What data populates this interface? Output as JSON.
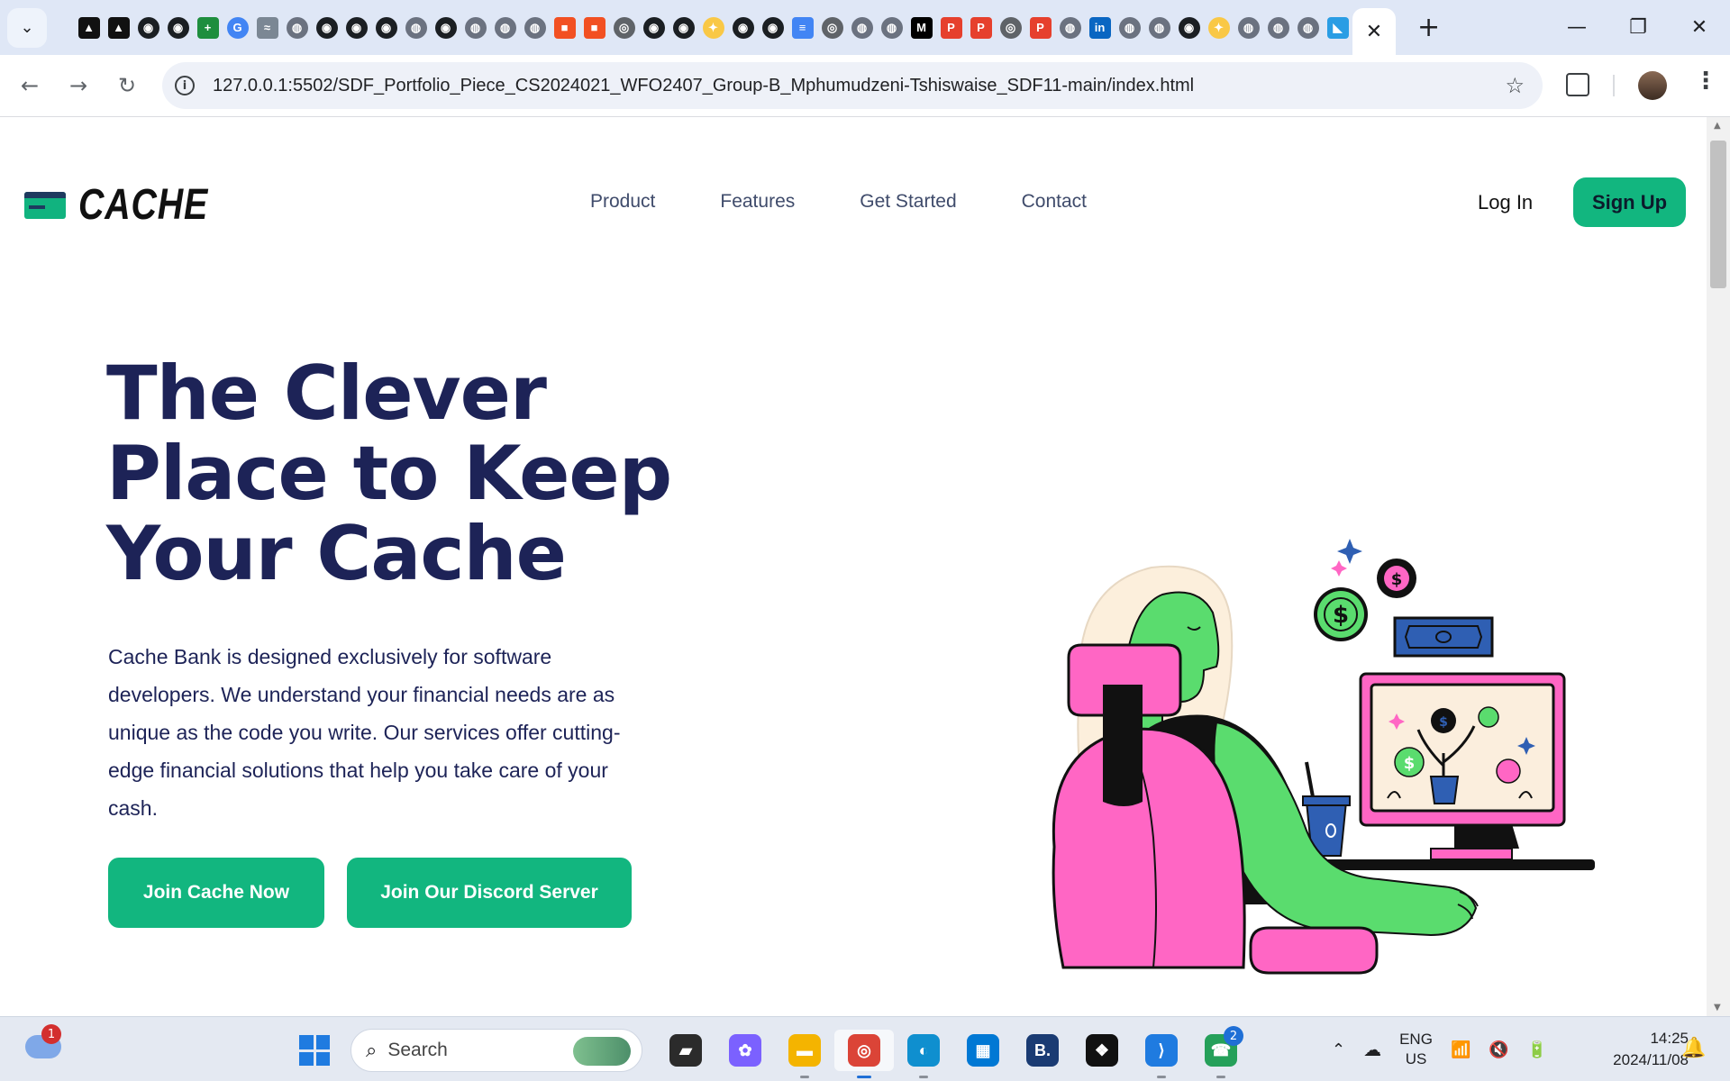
{
  "browser": {
    "active_tab_close": "✕",
    "new_tab": "+",
    "url": "127.0.0.1:5502/SDF_Portfolio_Piece_CS2024021_WFO2407_Group-B_Mphumudzeni-Tshiswaise_SDF11-main/index.html",
    "tab_favicons": [
      "vercel",
      "vercel",
      "github",
      "github",
      "sheets",
      "google",
      "wave",
      "globe",
      "github",
      "github",
      "github",
      "globe",
      "github",
      "globe",
      "globe",
      "globe",
      "microsoft",
      "microsoft",
      "chrome",
      "github",
      "github",
      "gemini",
      "github",
      "github",
      "docs",
      "chrome",
      "globe",
      "globe",
      "medium",
      "pexels",
      "pexels",
      "chrome",
      "pexels",
      "globe",
      "linkedin",
      "globe",
      "globe",
      "github",
      "gemini",
      "globe",
      "globe",
      "globe",
      "vscode"
    ]
  },
  "site": {
    "logo_text": "CACHE",
    "nav": [
      "Product",
      "Features",
      "Get Started",
      "Contact"
    ],
    "login_label": "Log In",
    "signup_label": "Sign Up",
    "hero_title": "The Clever Place to Keep Your Cache",
    "hero_text": "Cache Bank is designed exclusively for software developers. We understand your financial needs are as unique as the code you write. Our services offer cutting-edge financial solutions that help you take care of your cash.",
    "primary_cta": "Join Cache Now",
    "secondary_cta": "Join Our Discord Server",
    "colors": {
      "brand_green": "#12b67f",
      "heading_navy": "#1d2357",
      "illustration_pink": "#ff66c4",
      "illustration_green": "#5adc6e"
    }
  },
  "taskbar": {
    "weather_badge": "1",
    "search_label": "Search",
    "apps": [
      "file-explorer-alt",
      "copilot",
      "file-explorer",
      "chrome",
      "edge",
      "store",
      "booking",
      "dropbox",
      "vscode",
      "whatsapp"
    ],
    "whatsapp_badge": "2",
    "lang_line1": "ENG",
    "lang_line2": "US",
    "time": "14:25",
    "date": "2024/11/08"
  }
}
